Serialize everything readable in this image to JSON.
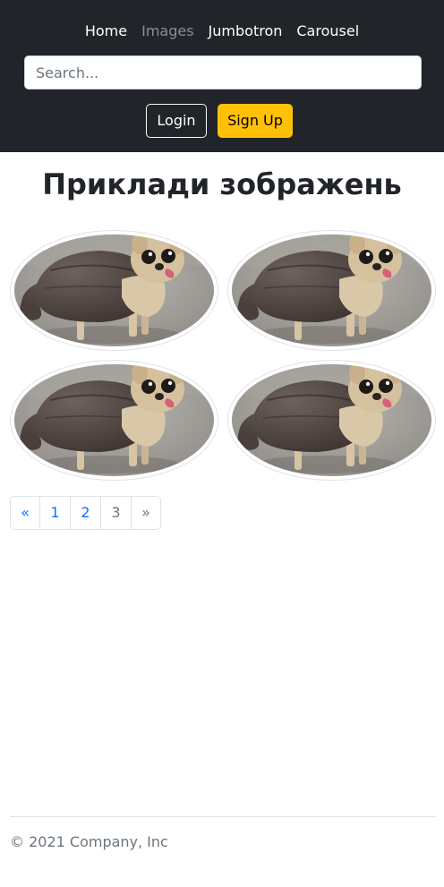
{
  "nav": {
    "items": [
      {
        "label": "Home",
        "active": false
      },
      {
        "label": "Images",
        "active": true
      },
      {
        "label": "Jumbotron",
        "active": false
      },
      {
        "label": "Carousel",
        "active": false
      }
    ]
  },
  "search": {
    "placeholder": "Search...",
    "value": ""
  },
  "auth": {
    "login_label": "Login",
    "signup_label": "Sign Up"
  },
  "main": {
    "title": "Приклади зображень",
    "images": [
      {
        "icon": "dog-in-cap-photo"
      },
      {
        "icon": "dog-in-cap-photo"
      },
      {
        "icon": "dog-in-cap-photo"
      },
      {
        "icon": "dog-in-cap-photo"
      }
    ]
  },
  "pagination": {
    "prev": "«",
    "pages": [
      "1",
      "2",
      "3"
    ],
    "current": "3",
    "next": "»"
  },
  "footer": {
    "copyright": "© 2021 Company, Inc"
  },
  "colors": {
    "header_bg": "#212529",
    "accent_yellow": "#ffc107",
    "link_blue": "#0d6efd",
    "muted": "#6c757d"
  }
}
